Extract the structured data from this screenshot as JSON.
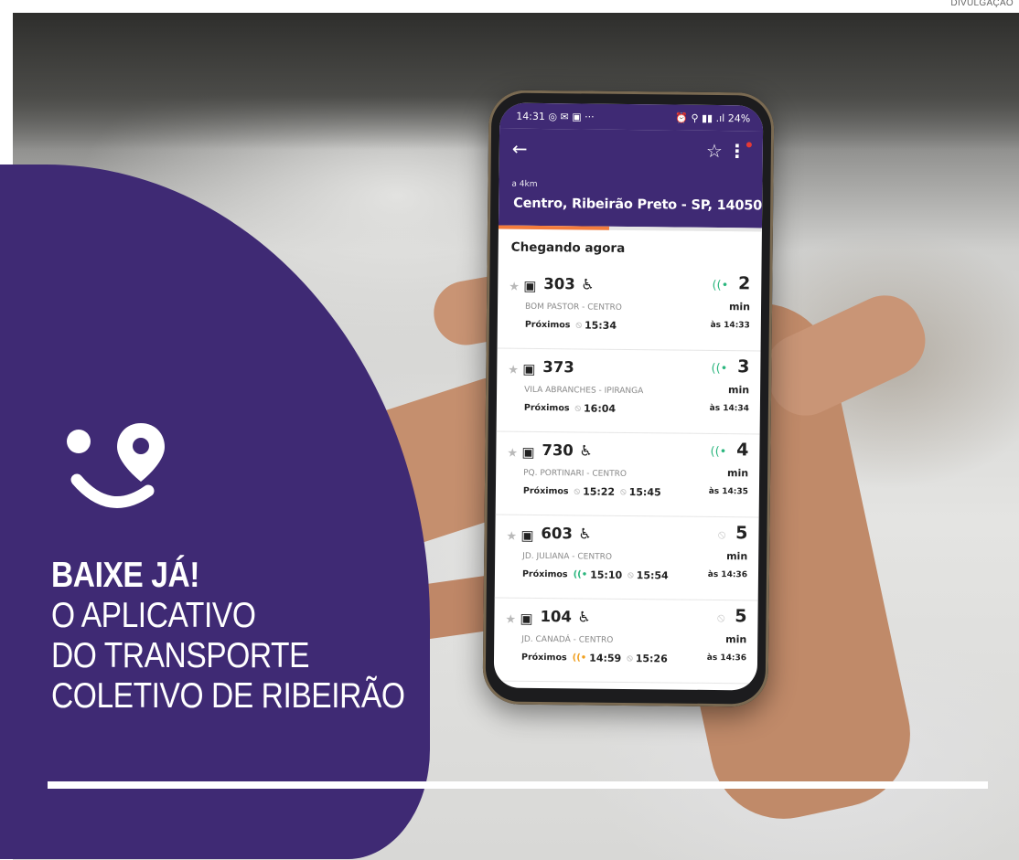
{
  "credit": "DIVULGAÇÃO",
  "promo": {
    "headline_bold": "BAIXE JÁ!",
    "headline_lines": [
      "O APLICATIVO",
      "DO TRANSPORTE",
      "COLETIVO DE RIBEIRÃO"
    ],
    "brand_color": "#3f2a74"
  },
  "phone": {
    "status": {
      "time": "14:31",
      "left_icons": "◎ ✉ ▣ ···",
      "right_icons": "⏰ ⚲ ▮▮ .ıl",
      "battery": "24%"
    },
    "header": {
      "back_icon": "←",
      "star_icon": "☆",
      "menu_icon": "⋮",
      "distance": "a 4km",
      "place": "Centro, Ribeirão Preto - SP, 14050-"
    },
    "progress": 0.42,
    "section_title": "Chegando agora",
    "arrivals": [
      {
        "line": "303",
        "accessible": true,
        "route": "BOM PASTOR - CENTRO",
        "next_label": "Próximos",
        "next": [
          {
            "time": "15:34",
            "signal": "off"
          }
        ],
        "eta": "2",
        "unit": "min",
        "at": "às 14:33",
        "live": true
      },
      {
        "line": "373",
        "accessible": false,
        "route": "VILA ABRANCHES - IPIRANGA",
        "next_label": "Próximos",
        "next": [
          {
            "time": "16:04",
            "signal": "off"
          }
        ],
        "eta": "3",
        "unit": "min",
        "at": "às 14:34",
        "live": true
      },
      {
        "line": "730",
        "accessible": true,
        "route": "PQ. PORTINARI - CENTRO",
        "next_label": "Próximos",
        "next": [
          {
            "time": "15:22",
            "signal": "off"
          },
          {
            "time": "15:45",
            "signal": "off"
          }
        ],
        "eta": "4",
        "unit": "min",
        "at": "às 14:35",
        "live": true
      },
      {
        "line": "603",
        "accessible": true,
        "route": "JD. JULIANA - CENTRO",
        "next_label": "Próximos",
        "next": [
          {
            "time": "15:10",
            "signal": "live"
          },
          {
            "time": "15:54",
            "signal": "off"
          }
        ],
        "eta": "5",
        "unit": "min",
        "at": "às 14:36",
        "live": false
      },
      {
        "line": "104",
        "accessible": true,
        "route": "JD. CANADÁ - CENTRO",
        "next_label": "Próximos",
        "next": [
          {
            "time": "14:59",
            "signal": "warn"
          },
          {
            "time": "15:26",
            "signal": "off"
          }
        ],
        "eta": "5",
        "unit": "min",
        "at": "às 14:36",
        "live": false
      }
    ]
  }
}
